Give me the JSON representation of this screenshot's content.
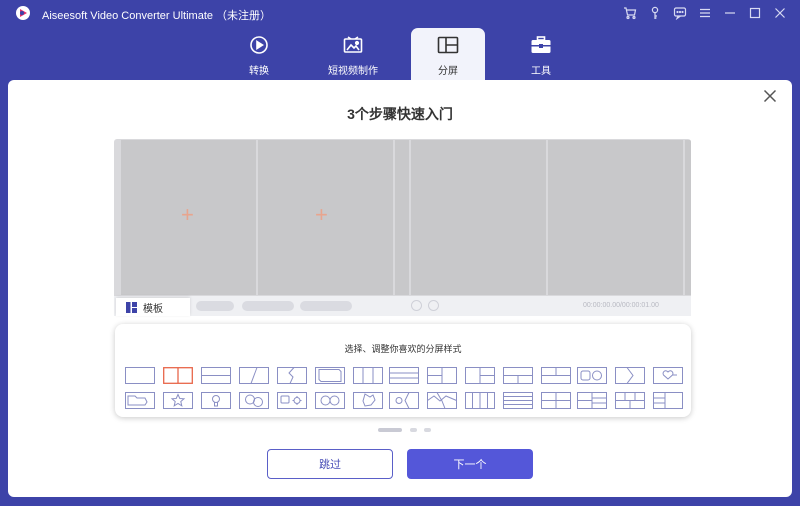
{
  "app": {
    "title": "Aiseesoft Video Converter Ultimate （未注册）",
    "window_icons": [
      "cart-icon",
      "key-icon",
      "chat-icon",
      "menu-icon",
      "minimize-icon",
      "maximize-icon",
      "close-icon"
    ]
  },
  "tabs": [
    {
      "label": "转换",
      "icon": "convert-icon",
      "active": false
    },
    {
      "label": "短视频制作",
      "icon": "mv-icon",
      "active": false
    },
    {
      "label": "分屏",
      "icon": "collage-icon",
      "active": true
    },
    {
      "label": "工具",
      "icon": "toolbox-icon",
      "active": false
    }
  ],
  "guide": {
    "heading": "3个步骤快速入门",
    "template_tab": "模板",
    "timecode": "00:00:00.00/00:00:01.00",
    "chooser_title": "选择、调整你喜欢的分屏样式",
    "skip_label": "跳过",
    "next_label": "下一个"
  },
  "colors": {
    "accent": "#5457d9",
    "titlebar": "#3d43a8",
    "selected_layout": "#e8664a"
  }
}
